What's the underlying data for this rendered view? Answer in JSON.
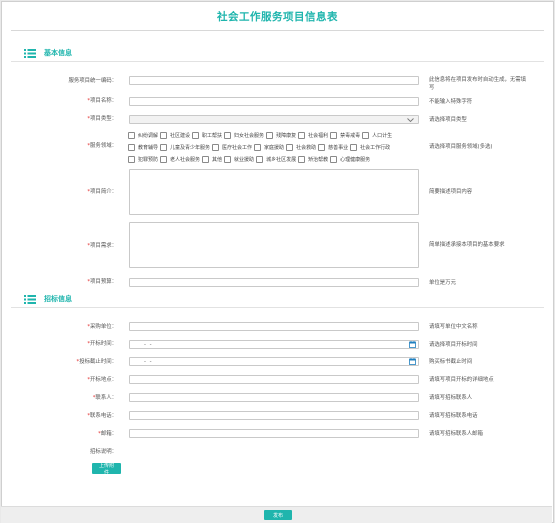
{
  "page": {
    "title": "社会工作服务项目信息表"
  },
  "sections": {
    "basic": "基本信息",
    "bidding": "招标信息"
  },
  "colors": {
    "accent": "#1fb5ad",
    "required": "#e22b2b"
  },
  "fields": {
    "code": {
      "label": "服务项目统一编码：",
      "hint": "此信息将在项目发布时自动生成，无需填写",
      "value": ""
    },
    "name": {
      "label": "项目名称：",
      "required_mark": "*",
      "hint": "不能输入特殊字符",
      "value": ""
    },
    "type": {
      "label": "项目类型：",
      "required_mark": "*",
      "hint": "请选择项目类型",
      "value": ""
    },
    "domain": {
      "label": "服务领域：",
      "required_mark": "*",
      "hint": "请选择项目服务领域(多选)"
    },
    "intro": {
      "label": "项目简介：",
      "required_mark": "*",
      "hint": "简要描述项目内容",
      "value": ""
    },
    "needs": {
      "label": "项目需求：",
      "required_mark": "*",
      "hint": "简单描述承接本项目的基本要求",
      "value": ""
    },
    "budget": {
      "label": "项目预算：",
      "required_mark": "*",
      "hint": "单位是万元",
      "value": ""
    },
    "purchaser": {
      "label": "采购单位：",
      "required_mark": "*",
      "hint": "请填写单位中文名称",
      "value": ""
    },
    "open_time": {
      "label": "开标时间：",
      "required_mark": "*",
      "hint": "请选择项目开标时间",
      "value": "-   -"
    },
    "deadline": {
      "label": "投标截止时间：",
      "required_mark": "*",
      "hint": "购买标书截止时间",
      "value": "-   -"
    },
    "open_place": {
      "label": "开标地点：",
      "required_mark": "*",
      "hint": "请填写项目开标的详细地点",
      "value": ""
    },
    "contact": {
      "label": "联系人：",
      "required_mark": "*",
      "hint": "请填写招标联系人",
      "value": ""
    },
    "phone": {
      "label": "联系电话：",
      "required_mark": "*",
      "hint": "请填写招标联系电话",
      "value": ""
    },
    "email": {
      "label": "邮箱：",
      "required_mark": "*",
      "hint": "请填写招标联系人邮箱",
      "value": ""
    },
    "bid_notes": {
      "label": "招标说明："
    }
  },
  "domain_options": {
    "row1": [
      "纠纷调解",
      "社区建设",
      "职工帮扶",
      "妇女社会服务",
      "残障康复",
      "社会福利",
      "禁毒戒毒",
      "人口计生"
    ],
    "row2": [
      "教育辅导",
      "儿童及青少年服务",
      "医疗社会工作",
      "家庭援助",
      "社会救助",
      "慈善事业",
      "社会工作行政"
    ],
    "row3": [
      "犯罪预防",
      "老人社会服务",
      "其他",
      "就业援助",
      "城乡社区发展",
      "矫治帮教",
      "心理健康服务"
    ]
  },
  "buttons": {
    "upload": "上传附件",
    "publish": "发布"
  },
  "icons": {
    "section": "list-icon",
    "select": "chevron-down-icon",
    "date": "calendar-icon"
  }
}
